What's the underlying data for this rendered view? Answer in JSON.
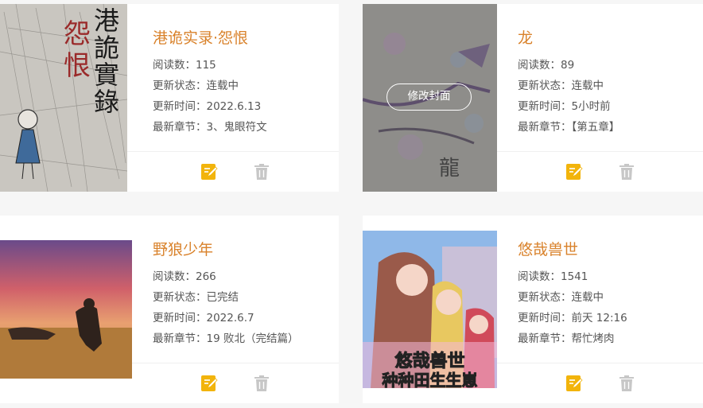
{
  "labels": {
    "reads": "阅读数：",
    "status": "更新状态：",
    "time": "更新时间：",
    "latest": "最新章节："
  },
  "colors": {
    "title": "#d9822b",
    "edit_icon": "#f2b40c",
    "delete_icon": "#c7c7c7"
  },
  "icons": {
    "edit": "edit-icon",
    "delete": "trash-icon"
  },
  "books": [
    {
      "title": "港诡实录·怨恨",
      "reads": "115",
      "status": "连载中",
      "time": "2022.6.13",
      "latest": "3、鬼眼符文",
      "cover_text_main": "港詭實錄",
      "cover_text_accent": "怨恨"
    },
    {
      "title": "龙",
      "reads": "89",
      "status": "连载中",
      "time": "5小时前",
      "latest": "【第五章】",
      "cover_button": "修改封面",
      "cover_text_main": "龍"
    },
    {
      "title": "野狼少年",
      "reads": "266",
      "status": "已完结",
      "time": "2022.6.7",
      "latest": "19 败北（完结篇）"
    },
    {
      "title": "悠哉兽世",
      "reads": "1541",
      "status": "连载中",
      "time": "前天 12:16",
      "latest": "帮忙烤肉",
      "cover_text_main": "悠哉兽世",
      "cover_text_sub": "种种田生生崽"
    }
  ]
}
